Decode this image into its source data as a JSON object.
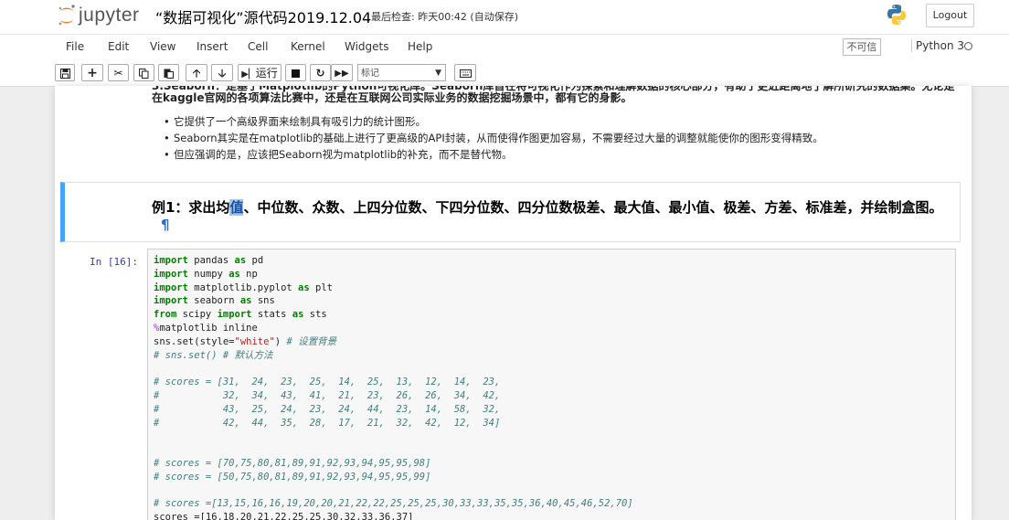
{
  "header": {
    "logo_text": "jupyter",
    "notebook_name": "“数据可视化”源代码2019.12.04",
    "checkpoint": "最后检查: 昨天00:42  (自动保存)",
    "logout": "Logout"
  },
  "menubar": {
    "items": [
      "File",
      "Edit",
      "View",
      "Insert",
      "Cell",
      "Kernel",
      "Widgets",
      "Help"
    ],
    "trusted": "不可信",
    "kernel": "Python 3"
  },
  "toolbar": {
    "run_label": "运行",
    "cell_type": "标记"
  },
  "notebook": {
    "intro_paragraph": "3.Seaborn：是基于Matplotlib的Python可视化库。Seaborn库旨在将可视化作为探索和理解数据的核心部分，有助于更近距离地了解所研究的数据集。无论是在kaggle官网的各项算法比赛中，还是在互联网公司实际业务的数据挖掘场景中，都有它的身影。",
    "bullets": [
      "它提供了一个高级界面来绘制具有吸引力的统计图形。",
      "Seaborn其实是在matplotlib的基础上进行了更高级的API封装，从而使得作图更加容易，不需要经过大量的调整就能使你的图形变得精致。",
      "但应强调的是，应该把Seaborn视为matplotlib的补充，而不是替代物。"
    ],
    "heading_before": "例1：求出均",
    "heading_highlight": "值",
    "heading_after": "、中位数、众数、上四分位数、下四分位数、四分位数极差、最大值、最小值、极差、方差、标准差，并绘制盒图。",
    "pilcrow": "¶",
    "in_prompt": "In  [16]:",
    "code_lines": [
      [
        [
          "kw",
          "import"
        ],
        [
          "t",
          " pandas "
        ],
        [
          "kw",
          "as"
        ],
        [
          "t",
          " pd"
        ]
      ],
      [
        [
          "kw",
          "import"
        ],
        [
          "t",
          " numpy "
        ],
        [
          "kw",
          "as"
        ],
        [
          "t",
          " np"
        ]
      ],
      [
        [
          "kw",
          "import"
        ],
        [
          "t",
          " matplotlib.pyplot "
        ],
        [
          "kw",
          "as"
        ],
        [
          "t",
          " plt"
        ]
      ],
      [
        [
          "kw",
          "import"
        ],
        [
          "t",
          " seaborn "
        ],
        [
          "kw",
          "as"
        ],
        [
          "t",
          " sns"
        ]
      ],
      [
        [
          "kw",
          "from"
        ],
        [
          "t",
          " scipy "
        ],
        [
          "kw",
          "import"
        ],
        [
          "t",
          " stats "
        ],
        [
          "kw",
          "as"
        ],
        [
          "t",
          " sts"
        ]
      ],
      [
        [
          "mg",
          "%"
        ],
        [
          "t",
          "matplotlib inline"
        ]
      ],
      [
        [
          "t",
          "sns.set(style="
        ],
        [
          "st",
          "\"white\""
        ],
        [
          "t",
          ") "
        ],
        [
          "cm",
          "# 设置背景"
        ]
      ],
      [
        [
          "cm",
          "# sns.set() # 默认方法"
        ]
      ],
      [
        [
          "t",
          ""
        ]
      ],
      [
        [
          "cm",
          "# scores = [31,  24,  23,  25,  14,  25,  13,  12,  14,  23,"
        ]
      ],
      [
        [
          "cm",
          "#           32,  34,  43,  41,  21,  23,  26,  26,  34,  42,"
        ]
      ],
      [
        [
          "cm",
          "#           43,  25,  24,  23,  24,  44,  23,  14,  58,  32,"
        ]
      ],
      [
        [
          "cm",
          "#           42,  44,  35,  28,  17,  21,  32,  42,  12,  34]"
        ]
      ],
      [
        [
          "t",
          ""
        ]
      ],
      [
        [
          "t",
          ""
        ]
      ],
      [
        [
          "cm",
          "# scores = [70,75,80,81,89,91,92,93,94,95,95,98]"
        ]
      ],
      [
        [
          "cm",
          "# scores = [50,75,80,81,89,91,92,93,94,95,95,99]"
        ]
      ],
      [
        [
          "t",
          ""
        ]
      ],
      [
        [
          "cm",
          "# scores =[13,15,16,16,19,20,20,21,22,22,25,25,25,30,33,33,35,35,36,40,45,46,52,70]"
        ]
      ],
      [
        [
          "t",
          "scores =[16,18,20,21,22,25,25,30,32,33,36,37]"
        ]
      ]
    ]
  },
  "colors": {
    "selected_cell_border": "#42a5f5",
    "keyword": "#008000",
    "comment": "#408080",
    "string": "#ba2121",
    "magic": "#aa22ff",
    "prompt": "#303f9f"
  }
}
